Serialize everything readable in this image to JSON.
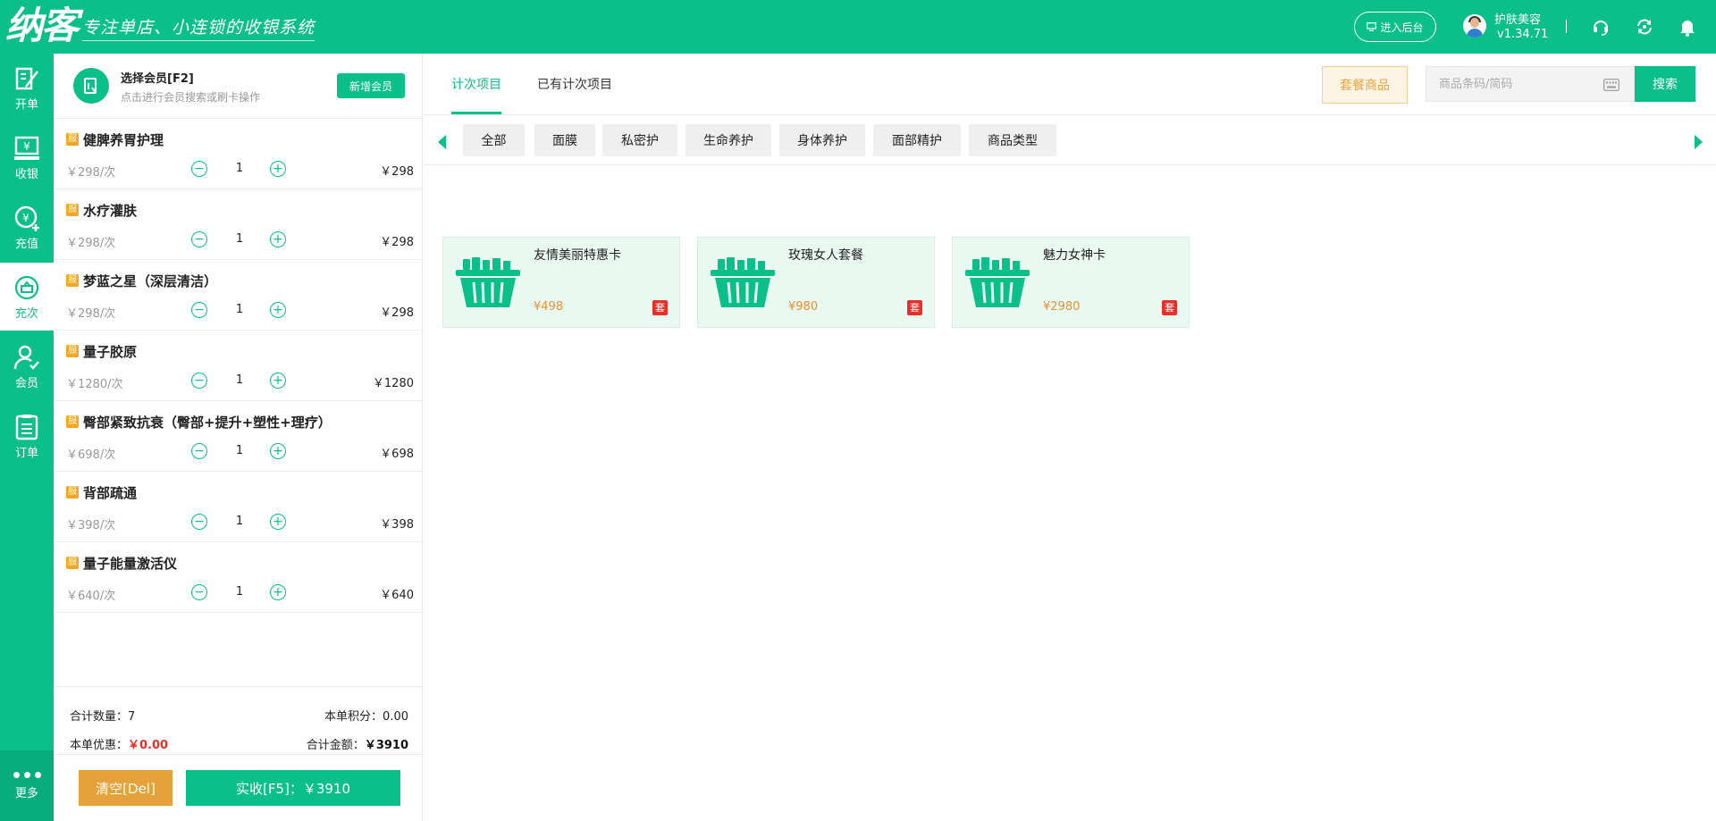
{
  "header": {
    "logo_text": "纳客",
    "slogan": "专注单店、小连锁的收银系统",
    "backend_button": "进入后台",
    "user_name": "护肤美容",
    "version": "v1.34.71"
  },
  "nav": {
    "items": [
      {
        "label": "开单",
        "icon": "edit-icon"
      },
      {
        "label": "收银",
        "icon": "yen-register-icon"
      },
      {
        "label": "充值",
        "icon": "recharge-icon"
      },
      {
        "label": "充次",
        "icon": "recharge-count-icon"
      },
      {
        "label": "会员",
        "icon": "member-icon"
      },
      {
        "label": "订单",
        "icon": "order-list-icon"
      }
    ],
    "active_index": 3,
    "more_label": "更多"
  },
  "member": {
    "title": "选择会员[F2]",
    "hint": "点击进行会员搜索或刷卡操作",
    "new_member_button": "新增会员"
  },
  "cart": {
    "tag": "服",
    "items": [
      {
        "name": "健脾养胃护理",
        "unit_price": "￥298/次",
        "qty": "1",
        "amount": "￥298"
      },
      {
        "name": "水疗灌肤",
        "unit_price": "￥298/次",
        "qty": "1",
        "amount": "￥298"
      },
      {
        "name": "梦蓝之星（深层清洁）",
        "unit_price": "￥298/次",
        "qty": "1",
        "amount": "￥298"
      },
      {
        "name": "量子胶原",
        "unit_price": "￥1280/次",
        "qty": "1",
        "amount": "￥1280"
      },
      {
        "name": "臀部紧致抗衰（臀部+提升+塑性+理疗）",
        "unit_price": "￥698/次",
        "qty": "1",
        "amount": "￥698"
      },
      {
        "name": "背部疏通",
        "unit_price": "￥398/次",
        "qty": "1",
        "amount": "￥398"
      },
      {
        "name": "量子能量激活仪",
        "unit_price": "￥640/次",
        "qty": "1",
        "amount": "￥640"
      }
    ]
  },
  "summary": {
    "total_qty_label": "合计数量：",
    "total_qty": "7",
    "points_label": "本单积分：",
    "points": "0.00",
    "discount_label": "本单优惠：",
    "discount": "￥0.00",
    "total_amount_label": "合计金额：",
    "total_amount": "￥3910",
    "clear_button": "清空[Del]",
    "pay_button": "实收[F5]：￥3910"
  },
  "main": {
    "tabs": [
      {
        "label": "计次项目",
        "active": true
      },
      {
        "label": "已有计次项目",
        "active": false
      }
    ],
    "package_button": "套餐商品",
    "search_placeholder": "商品条码/简码",
    "search_button": "搜索",
    "categories": [
      "全部",
      "面膜",
      "私密护",
      "生命养护",
      "身体养护",
      "面部精护",
      "商品类型"
    ],
    "products": [
      {
        "name": "友情美丽特惠卡",
        "price": "¥498",
        "badge": "套"
      },
      {
        "name": "玫瑰女人套餐",
        "price": "¥980",
        "badge": "套"
      },
      {
        "name": "魅力女神卡",
        "price": "¥2980",
        "badge": "套"
      }
    ]
  },
  "colors": {
    "brand": "#0abf88",
    "accent_orange": "#e5a23a",
    "price_orange": "#e8922f",
    "danger": "#e8302b"
  }
}
